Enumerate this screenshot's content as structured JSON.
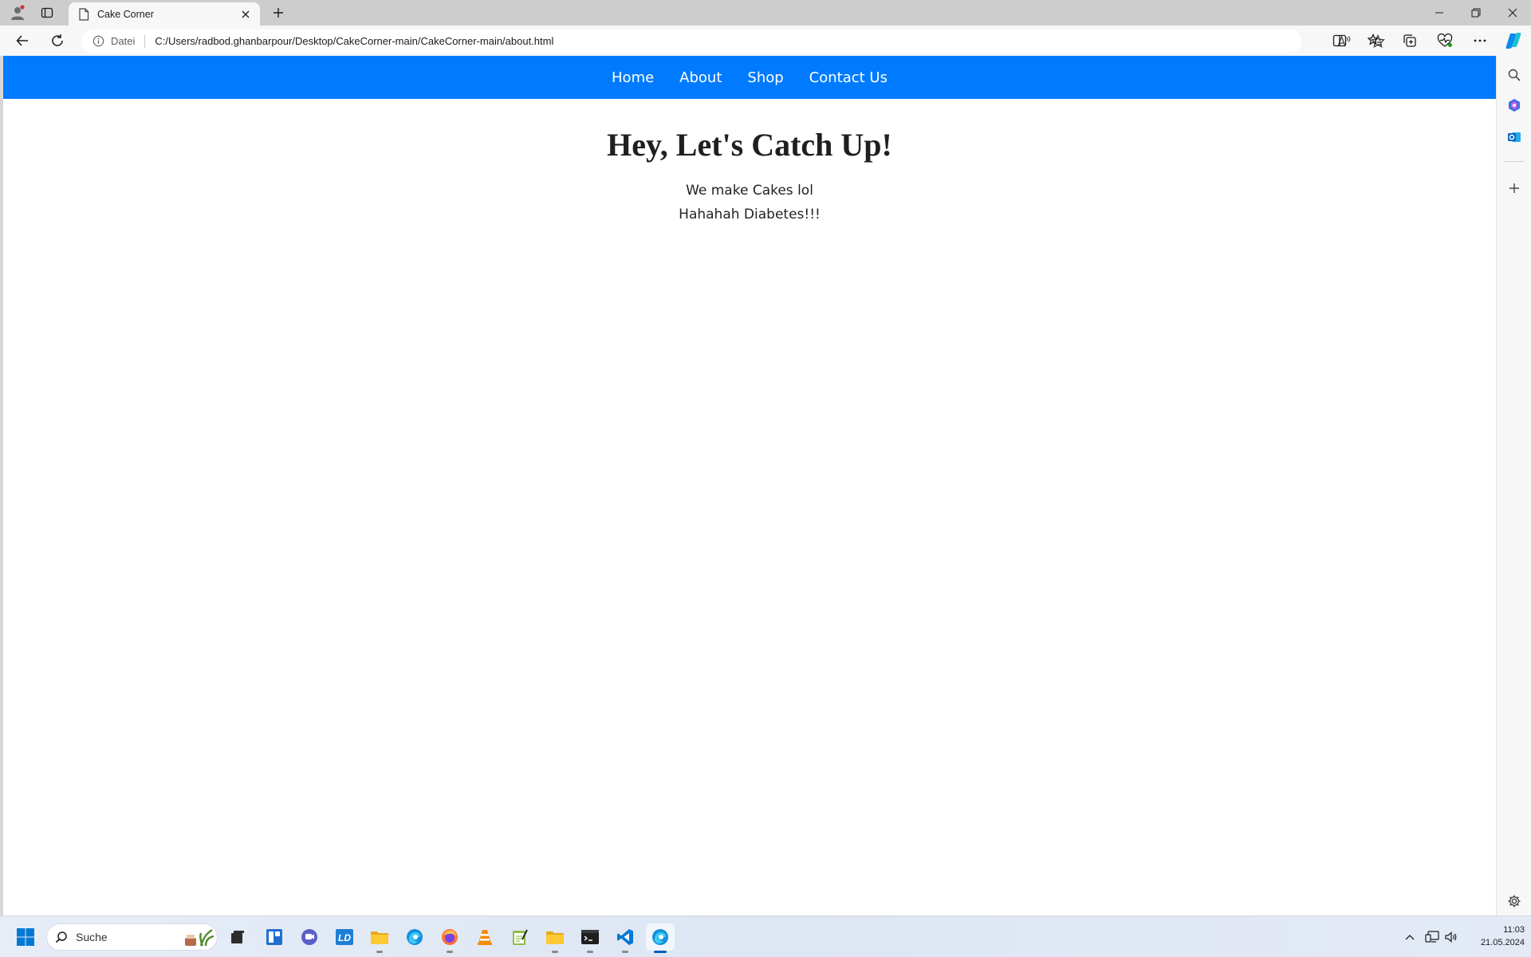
{
  "browser": {
    "tab_title": "Cake Corner",
    "info_label": "Datei",
    "url": "C:/Users/radbod.ghanbarpour/Desktop/CakeCorner-main/CakeCorner-main/about.html"
  },
  "site": {
    "nav": [
      "Home",
      "About",
      "Shop",
      "Contact Us"
    ],
    "title": "Hey, Let's Catch Up!",
    "line1": "We make Cakes lol",
    "line2": "Hahahah Diabetes!!!"
  },
  "taskbar": {
    "search_placeholder": "Suche",
    "time": "11:03",
    "date": "21.05.2024"
  },
  "colors": {
    "nav_bg": "#007bff",
    "edge_accent": "#0078d4"
  }
}
